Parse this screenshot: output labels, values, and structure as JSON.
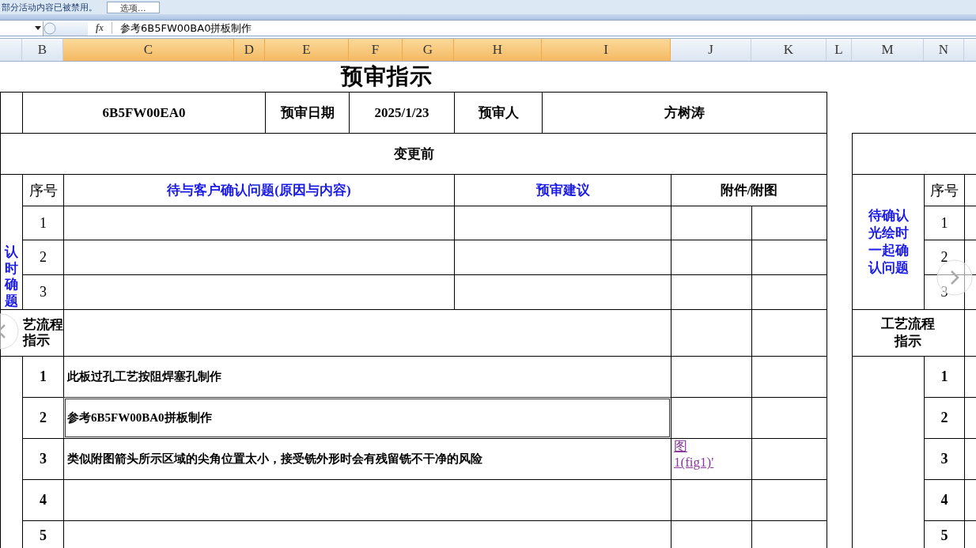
{
  "message_bar": {
    "text": "部分活动内容已被禁用。",
    "button": "选项..."
  },
  "formula_bar": {
    "fx": "fx",
    "content": "参考6B5FW00BA0拼板制作"
  },
  "column_headers": [
    {
      "label": "B",
      "selected": false
    },
    {
      "label": "C",
      "selected": true
    },
    {
      "label": "D",
      "selected": true
    },
    {
      "label": "E",
      "selected": true
    },
    {
      "label": "F",
      "selected": true
    },
    {
      "label": "G",
      "selected": true
    },
    {
      "label": "H",
      "selected": true
    },
    {
      "label": "I",
      "selected": true
    },
    {
      "label": "J",
      "selected": false
    },
    {
      "label": "K",
      "selected": false
    },
    {
      "label": "L",
      "selected": false
    },
    {
      "label": "M",
      "selected": false
    },
    {
      "label": "N",
      "selected": false
    }
  ],
  "sheet": {
    "title": "预审指示",
    "part_no": "6B5FW00EA0",
    "review_date_label": "预审日期",
    "review_date": "2025/1/23",
    "reviewer_label": "预审人",
    "reviewer": "方树涛",
    "section": "变更前",
    "questions": {
      "side_label_lines": [
        "认",
        "时",
        "确",
        "题"
      ],
      "no_header": "序号",
      "question_header": "待与客户确认问题(原因与内容)",
      "suggestion_header": "预审建议",
      "attachment_header": "附件/附图",
      "rows": [
        {
          "no": "1"
        },
        {
          "no": "2"
        },
        {
          "no": "3"
        }
      ]
    },
    "process": {
      "label_lines": [
        "艺流程",
        "指示"
      ],
      "rows": [
        {
          "no": "1",
          "text": "此板过孔工艺按阻焊塞孔制作",
          "selected": false
        },
        {
          "no": "2",
          "text": "参考6B5FW00BA0拼板制作",
          "selected": true
        },
        {
          "no": "3",
          "text": "类似附图箭头所示区域的尖角位置太小，接受铣外形时会有残留铣不干净的风险",
          "selected": false,
          "link": "图\n1(fig1)'"
        },
        {
          "no": "4",
          "selected": false
        },
        {
          "no": "5",
          "selected": false
        }
      ]
    }
  },
  "right_sheet": {
    "question_label": "待确认光绘时一起确认问题",
    "no_header": "序号",
    "question_rows": [
      "1",
      "2",
      "3"
    ],
    "process_label": "工艺流程指示",
    "process_rows": [
      "1",
      "2",
      "3",
      "4",
      "5"
    ]
  }
}
